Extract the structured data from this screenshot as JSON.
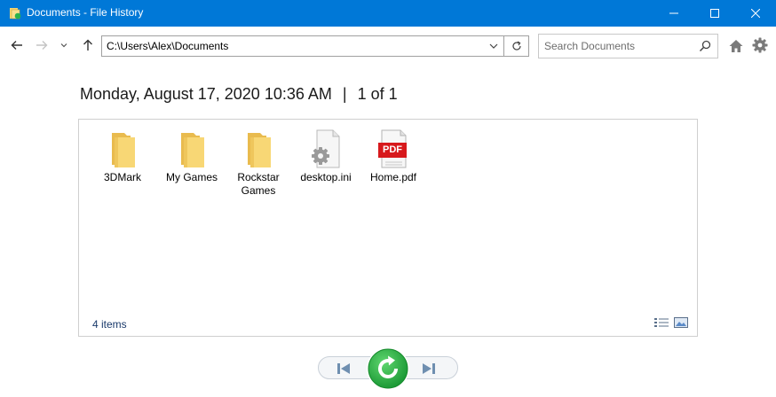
{
  "window": {
    "title": "Documents - File History",
    "icons": [
      "file-history-icon",
      "minimize-icon",
      "maximize-icon",
      "close-icon"
    ]
  },
  "toolbar": {
    "address_value": "C:\\Users\\Alex\\Documents",
    "search_placeholder": "Search Documents",
    "icons": [
      "back-arrow-icon",
      "forward-arrow-icon",
      "recent-dropdown-icon",
      "up-arrow-icon",
      "chevron-down-icon",
      "refresh-icon",
      "search-icon",
      "home-icon",
      "gear-icon"
    ]
  },
  "header": {
    "date": "Monday, August 17, 2020 10:36 AM",
    "separator": "|",
    "page": "1 of 1"
  },
  "files": [
    {
      "name": "3DMark",
      "type": "folder"
    },
    {
      "name": "My Games",
      "type": "folder"
    },
    {
      "name": "Rockstar Games",
      "type": "folder"
    },
    {
      "name": "desktop.ini",
      "type": "ini"
    },
    {
      "name": "Home.pdf",
      "type": "pdf",
      "badge": "PDF"
    }
  ],
  "status": {
    "count": "4 items"
  },
  "colors": {
    "titlebar": "#0078d7",
    "folder": "#f8d775",
    "pdf": "#d7191c",
    "restore_button": "#2bb24c"
  }
}
